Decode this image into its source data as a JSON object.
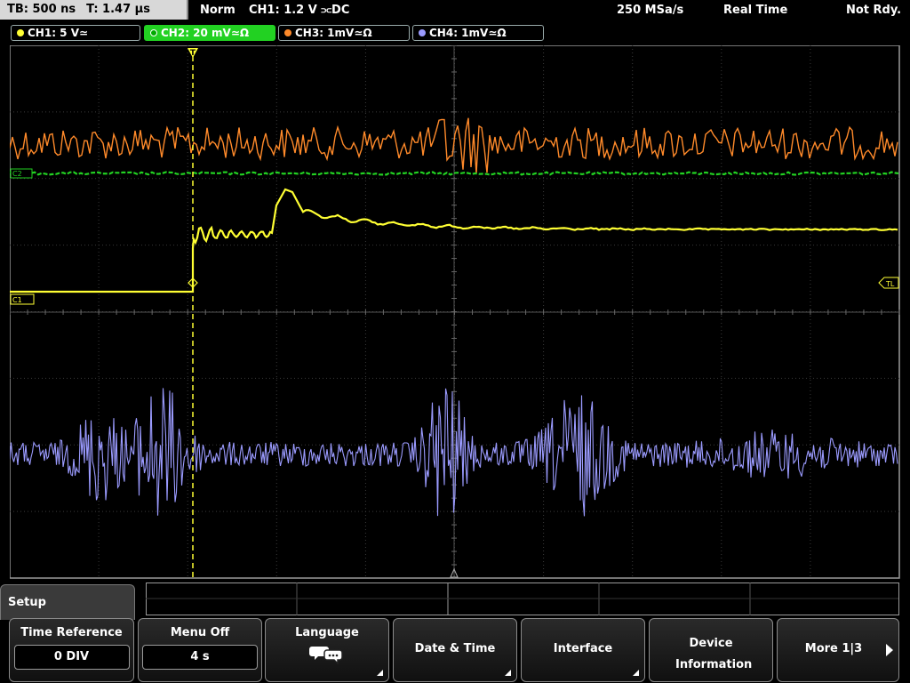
{
  "status": {
    "timebase": "TB: 500 ns",
    "trigger_time": "T: 1.47 µs",
    "mode": "Norm",
    "trigger": "CH1: 1.2 V ⫗DC",
    "sample_rate": "250 MSa/s",
    "acq_mode": "Real Time",
    "state": "Not Rdy."
  },
  "channels": [
    {
      "label": "CH1: 5 V≃",
      "color": "#ffff33"
    },
    {
      "label": "CH2: 20 mV≃Ω",
      "color": "#22d122"
    },
    {
      "label": "CH3: 1mV≃Ω",
      "color": "#ff8a2a"
    },
    {
      "label": "CH4: 1mV≃Ω",
      "color": "#9b9bff"
    }
  ],
  "markers": {
    "ch1": "C1",
    "ch2": "C2",
    "trigger_level": "TL",
    "trigger_pos": "T"
  },
  "menu": {
    "title": "Setup",
    "buttons": [
      {
        "label": "Time Reference",
        "value": "0 DIV"
      },
      {
        "label": "Menu Off",
        "value": "4 s"
      },
      {
        "label": "Language",
        "icon": "speech-bubbles-icon"
      },
      {
        "label": "Date & Time"
      },
      {
        "label": "Interface"
      },
      {
        "label": "Device Information"
      },
      {
        "label": "More 1|3"
      }
    ]
  }
}
